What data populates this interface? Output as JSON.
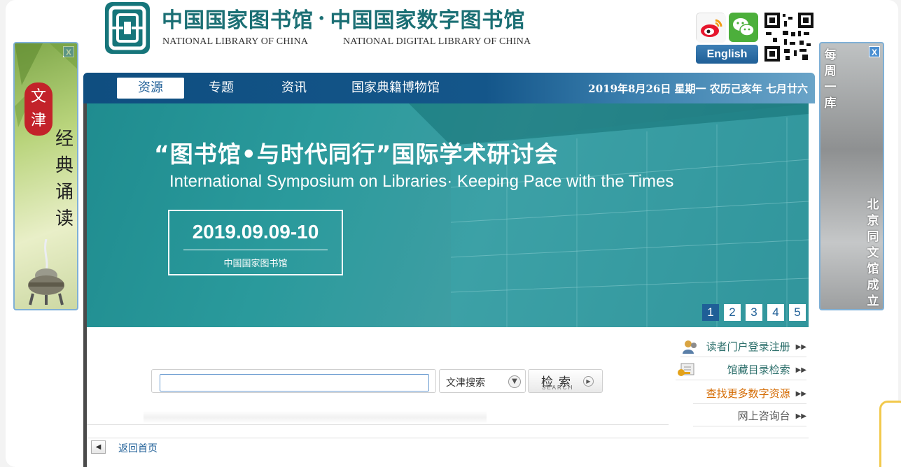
{
  "header": {
    "title_library": "中国国家图书馆",
    "title_separator": "·",
    "title_digital": "中国国家数字图书馆",
    "subtitle_library": "NATIONAL LIBRARY OF CHINA",
    "subtitle_digital": "NATIONAL DIGITAL  LIBRARY OF CHINA",
    "english_button": "English",
    "social_icons": [
      "weibo-icon",
      "wechat-icon",
      "qr-code-icon"
    ]
  },
  "left_ad": {
    "close": "X",
    "seal_text": "文津",
    "vertical_text": "经典诵读"
  },
  "right_ad": {
    "close": "X",
    "top_text": "每周一库",
    "bottom_text": "北京同文馆成立"
  },
  "nav": {
    "items": [
      {
        "label": "资源",
        "active": true
      },
      {
        "label": "专题",
        "active": false
      },
      {
        "label": "资讯",
        "active": false
      },
      {
        "label": "国家典籍博物馆",
        "active": false
      }
    ],
    "date_text": "2019年8月26日  星期一   农历己亥年   七月廿六"
  },
  "hero": {
    "title": "“图书馆•与时代同行”国际学术研讨会",
    "subtitle": "International Symposium on Libraries· Keeping Pace with the Times",
    "date": "2019.09.09-10",
    "organizer": "中国国家图书馆",
    "pages": [
      "1",
      "2",
      "3",
      "4",
      "5"
    ],
    "active_page": 1
  },
  "search": {
    "input_value": "",
    "scope_label": "文津搜索",
    "button_label": "检索",
    "button_sub": "SEARCH"
  },
  "quick_links": [
    {
      "label": "读者门户登录注册",
      "icon": "user-icon"
    },
    {
      "label": "馆藏目录检索",
      "icon": "key-card-icon"
    },
    {
      "label": "查找更多数字资源",
      "icon": ""
    },
    {
      "label": "网上咨询台",
      "icon": ""
    }
  ],
  "footer": {
    "back_label": "返回首页"
  },
  "colors": {
    "brand_teal": "#1b6f74",
    "nav_blue": "#14568a",
    "link_orange": "#d46a00"
  }
}
